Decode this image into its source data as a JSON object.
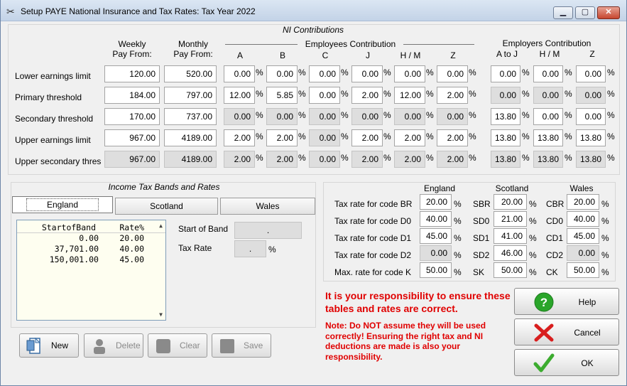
{
  "window": {
    "title": "Setup PAYE National Insurance and Tax Rates: Tax Year 2022",
    "minimize": "▁",
    "maximize": "▢",
    "close": "✕"
  },
  "ni": {
    "title": "NI Contributions",
    "col_weekly": [
      "Weekly",
      "Pay From:"
    ],
    "col_monthly": [
      "Monthly",
      "Pay From:"
    ],
    "employees_title": "Employees Contribution",
    "employers_title": "Employers Contribution",
    "employee_cols": [
      "A",
      "B",
      "C",
      "J",
      "H / M",
      "Z"
    ],
    "employer_cols": [
      "A to J",
      "H / M",
      "Z"
    ],
    "pct": "%",
    "rows": [
      {
        "label": "Lower earnings limit",
        "weekly": "120.00",
        "monthly": "520.00",
        "ee": [
          "0.00",
          "0.00",
          "0.00",
          "0.00",
          "0.00",
          "0.00"
        ],
        "ee_dis": [
          false,
          false,
          false,
          false,
          false,
          false
        ],
        "er": [
          "0.00",
          "0.00",
          "0.00"
        ],
        "er_dis": [
          false,
          false,
          false
        ],
        "wk_dis": false
      },
      {
        "label": "Primary threshold",
        "weekly": "184.00",
        "monthly": "797.00",
        "ee": [
          "12.00",
          "5.85",
          "0.00",
          "2.00",
          "12.00",
          "2.00"
        ],
        "ee_dis": [
          false,
          false,
          false,
          false,
          false,
          false
        ],
        "er": [
          "0.00",
          "0.00",
          "0.00"
        ],
        "er_dis": [
          true,
          true,
          true
        ],
        "wk_dis": false
      },
      {
        "label": "Secondary threshold",
        "weekly": "170.00",
        "monthly": "737.00",
        "ee": [
          "0.00",
          "0.00",
          "0.00",
          "0.00",
          "0.00",
          "0.00"
        ],
        "ee_dis": [
          true,
          true,
          true,
          true,
          true,
          true
        ],
        "er": [
          "13.80",
          "0.00",
          "0.00"
        ],
        "er_dis": [
          false,
          false,
          false
        ],
        "wk_dis": false
      },
      {
        "label": "Upper earnings limit",
        "weekly": "967.00",
        "monthly": "4189.00",
        "ee": [
          "2.00",
          "2.00",
          "0.00",
          "2.00",
          "2.00",
          "2.00"
        ],
        "ee_dis": [
          false,
          false,
          true,
          false,
          false,
          false
        ],
        "er": [
          "13.80",
          "13.80",
          "13.80"
        ],
        "er_dis": [
          false,
          false,
          false
        ],
        "wk_dis": false
      },
      {
        "label": "Upper secondary thres",
        "weekly": "967.00",
        "monthly": "4189.00",
        "ee": [
          "2.00",
          "2.00",
          "0.00",
          "2.00",
          "2.00",
          "2.00"
        ],
        "ee_dis": [
          true,
          true,
          true,
          true,
          true,
          true
        ],
        "er": [
          "13.80",
          "13.80",
          "13.80"
        ],
        "er_dis": [
          true,
          true,
          true
        ],
        "wk_dis": true
      }
    ]
  },
  "income_tax": {
    "title": "Income Tax Bands and Rates",
    "tabs": [
      "England",
      "Scotland",
      "Wales"
    ],
    "list_headers": [
      "StartofBand",
      "Rate%"
    ],
    "bands": [
      [
        "0.00",
        "20.00"
      ],
      [
        "37,701.00",
        "40.00"
      ],
      [
        "150,001.00",
        "45.00"
      ]
    ],
    "start_label": "Start of Band",
    "start_value": ".",
    "rate_label": "Tax Rate",
    "rate_value": ".",
    "pct": "%"
  },
  "tax_codes": {
    "col_headers": [
      "England",
      "Scotland",
      "Wales"
    ],
    "pct": "%",
    "rows": [
      {
        "label": "Tax rate for code BR",
        "eng": "20.00",
        "sco_label": "SBR",
        "sco": "20.00",
        "wal_label": "CBR",
        "wal": "20.00",
        "dis": [
          false,
          false,
          false
        ]
      },
      {
        "label": "Tax rate for code D0",
        "eng": "40.00",
        "sco_label": "SD0",
        "sco": "21.00",
        "wal_label": "CD0",
        "wal": "40.00",
        "dis": [
          false,
          false,
          false
        ]
      },
      {
        "label": "Tax rate for code D1",
        "eng": "45.00",
        "sco_label": "SD1",
        "sco": "41.00",
        "wal_label": "CD1",
        "wal": "45.00",
        "dis": [
          false,
          false,
          false
        ]
      },
      {
        "label": "Tax rate for code D2",
        "eng": "0.00",
        "sco_label": "SD2",
        "sco": "46.00",
        "wal_label": "CD2",
        "wal": "0.00",
        "dis": [
          true,
          false,
          true
        ]
      },
      {
        "label": "Max. rate for code K",
        "eng": "50.00",
        "sco_label": "SK",
        "sco": "50.00",
        "wal_label": "CK",
        "wal": "50.00",
        "dis": [
          false,
          false,
          false
        ]
      }
    ]
  },
  "buttons": {
    "new": "New",
    "delete": "Delete",
    "clear": "Clear",
    "save": "Save",
    "help": "Help",
    "cancel": "Cancel",
    "ok": "OK"
  },
  "notice": {
    "main": "It is your responsibility to ensure these tables and rates are correct.",
    "note": "Note: Do NOT assume they will be used correctly!  Ensuring the right tax and NI deductions are made is also your responsibility."
  },
  "colors": {
    "warning": "#e00000",
    "help": "#2aa52a",
    "cancel": "#d81e1e",
    "ok": "#3cac2f"
  }
}
